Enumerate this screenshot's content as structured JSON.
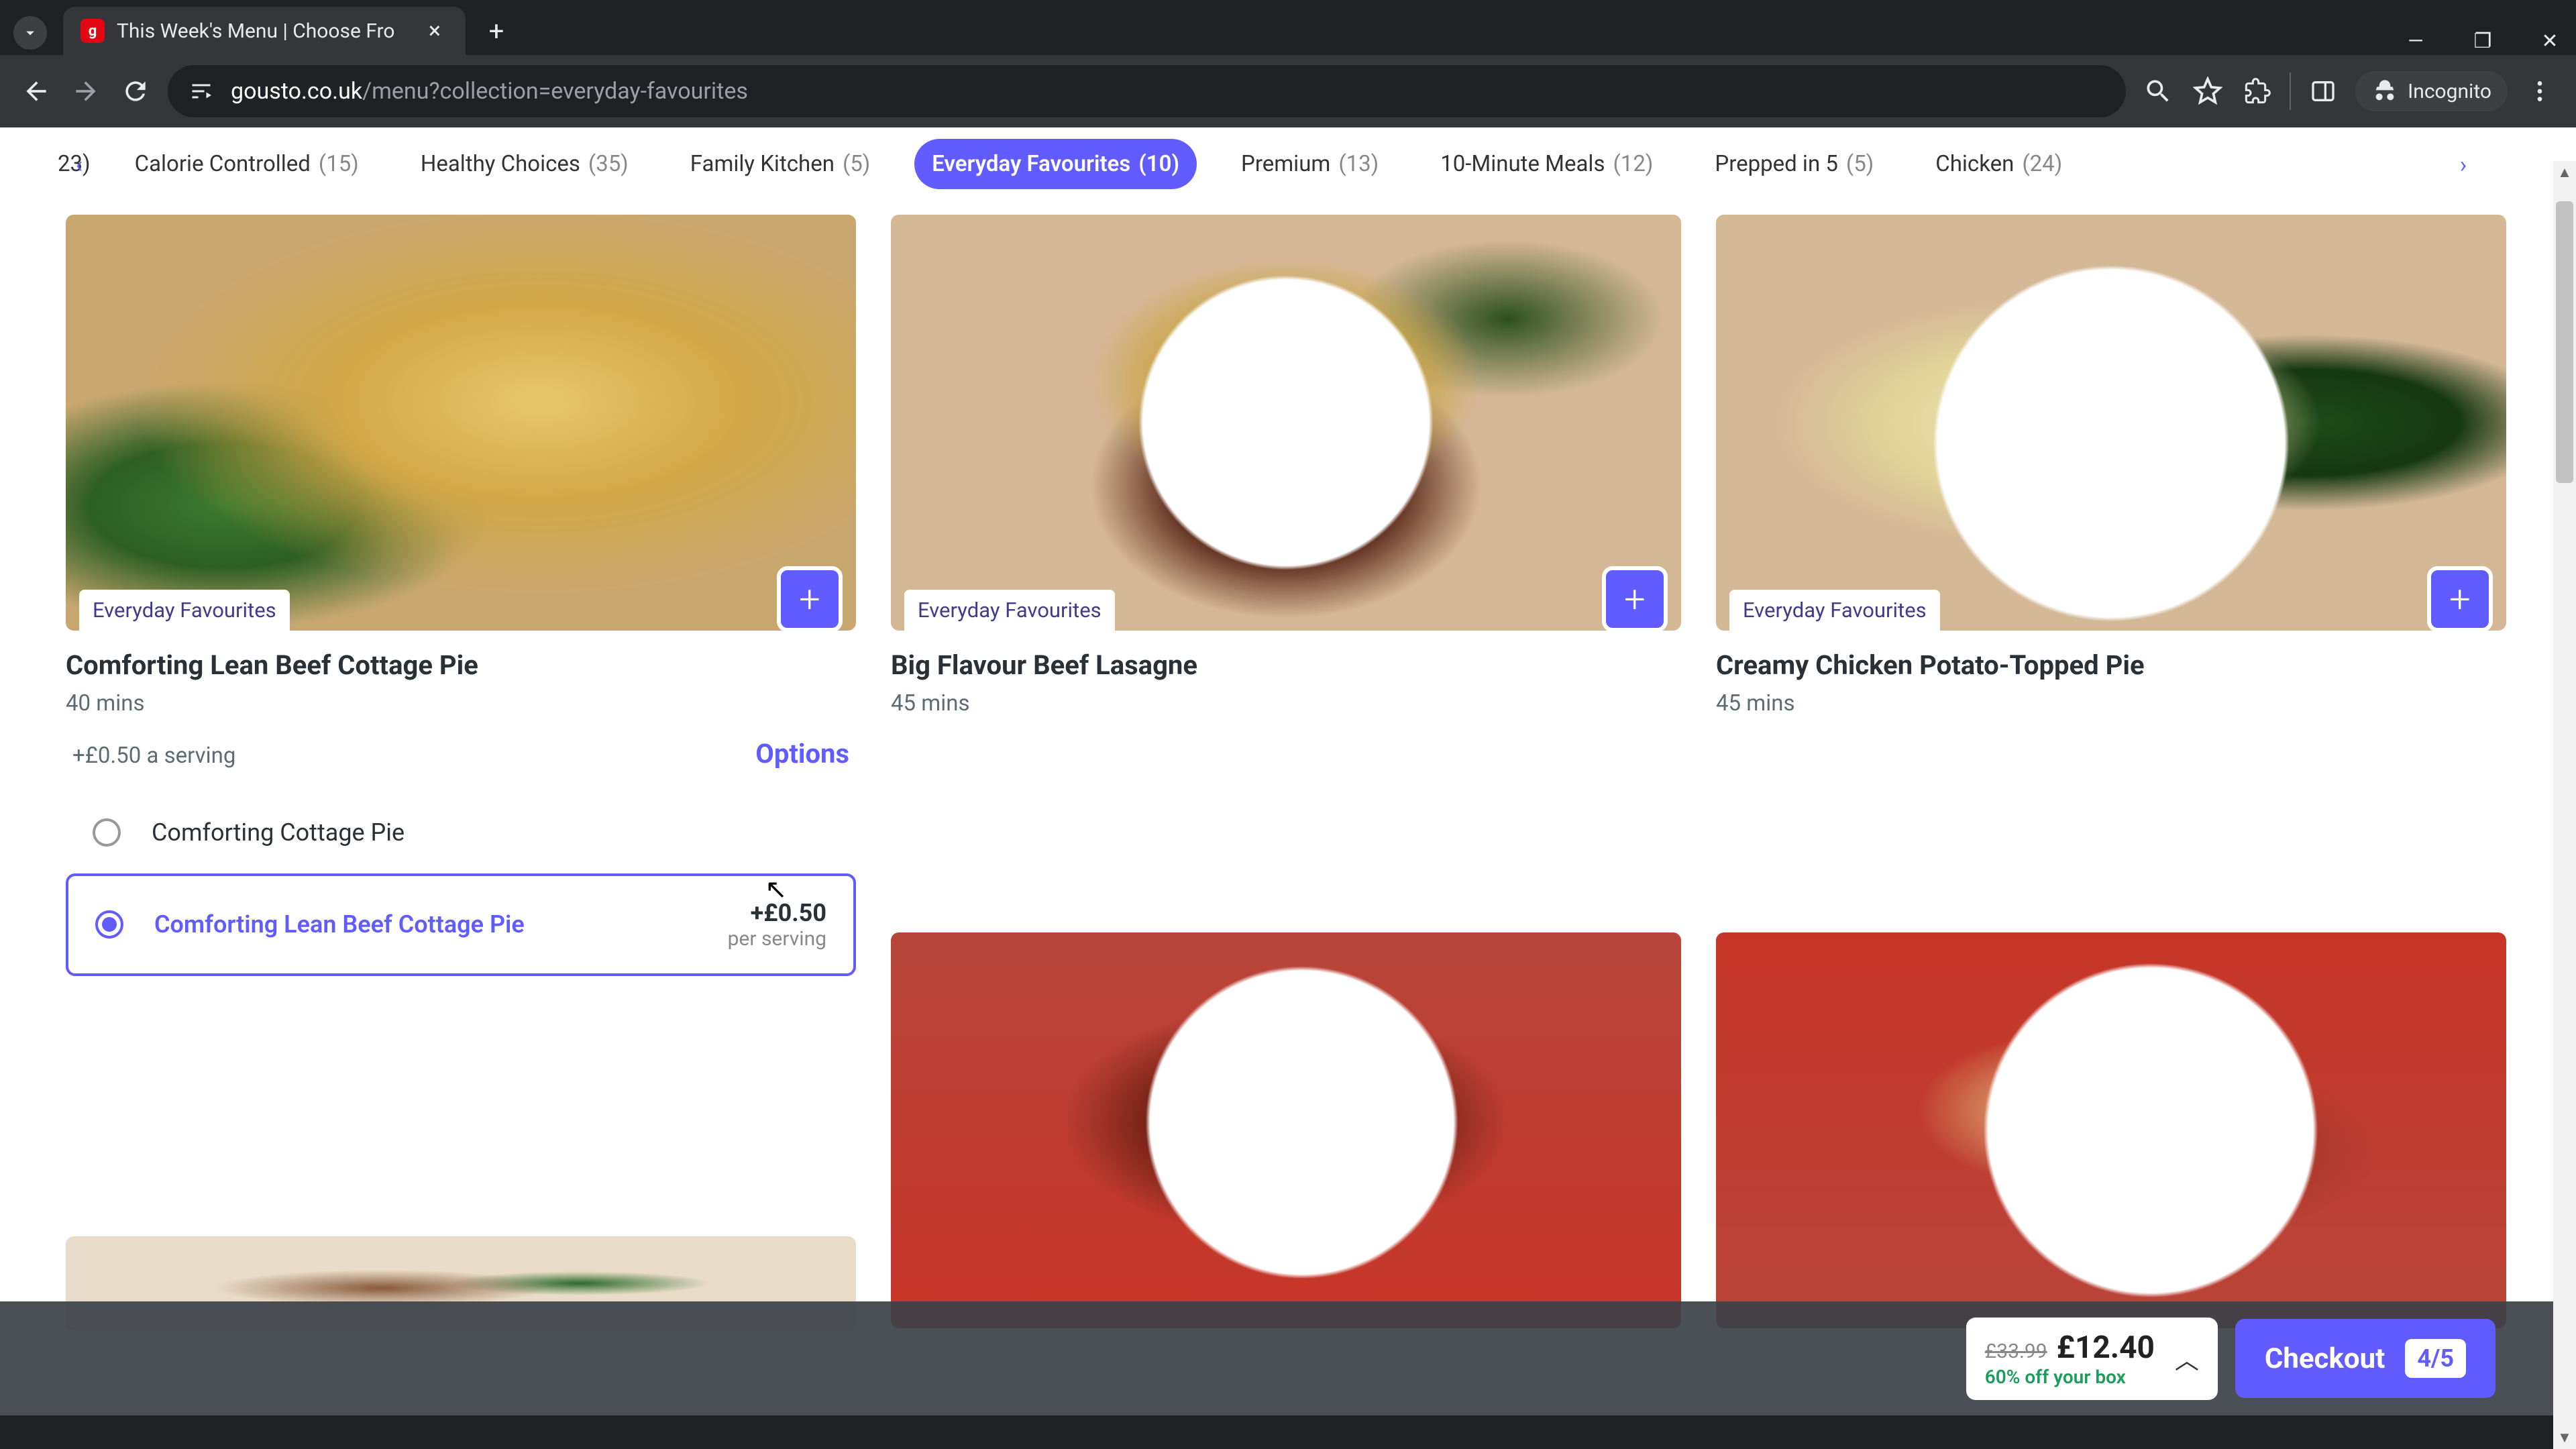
{
  "browser": {
    "tab_title": "This Week's Menu | Choose Fro",
    "url_domain": "gousto.co.uk",
    "url_path": "/menu?collection=everyday-favourites",
    "incognito_label": "Incognito"
  },
  "categories": {
    "partial_left": "23)",
    "items": [
      {
        "label": "Calorie Controlled",
        "count": "(15)",
        "active": false
      },
      {
        "label": "Healthy Choices",
        "count": "(35)",
        "active": false
      },
      {
        "label": "Family Kitchen",
        "count": "(5)",
        "active": false
      },
      {
        "label": "Everyday Favourites",
        "count": "(10)",
        "active": true
      },
      {
        "label": "Premium",
        "count": "(13)",
        "active": false
      },
      {
        "label": "10-Minute Meals",
        "count": "(12)",
        "active": false
      },
      {
        "label": "Prepped in 5",
        "count": "(5)",
        "active": false
      },
      {
        "label": "Chicken",
        "count": "(24)",
        "active": false
      }
    ]
  },
  "recipes": [
    {
      "tag": "Everyday Favourites",
      "title": "Comforting Lean Beef Cottage Pie",
      "time": "40 mins"
    },
    {
      "tag": "Everyday Favourites",
      "title": "Big Flavour Beef Lasagne",
      "time": "45 mins"
    },
    {
      "tag": "Everyday Favourites",
      "title": "Creamy Chicken Potato-Topped Pie",
      "time": "45 mins"
    }
  ],
  "options": {
    "price_note": "+£0.50 a serving",
    "heading": "Options",
    "unselected_label": "Comforting Cottage Pie",
    "selected_label": "Comforting Lean Beef Cottage Pie",
    "selected_price": "+£0.50",
    "selected_per": "per serving"
  },
  "checkout": {
    "price_old": "£33.99",
    "price_new": "£12.40",
    "discount": "60% off your box",
    "button_label": "Checkout",
    "count": "4/5"
  },
  "colors": {
    "primary": "#615cff",
    "success": "#1a9e5a"
  }
}
